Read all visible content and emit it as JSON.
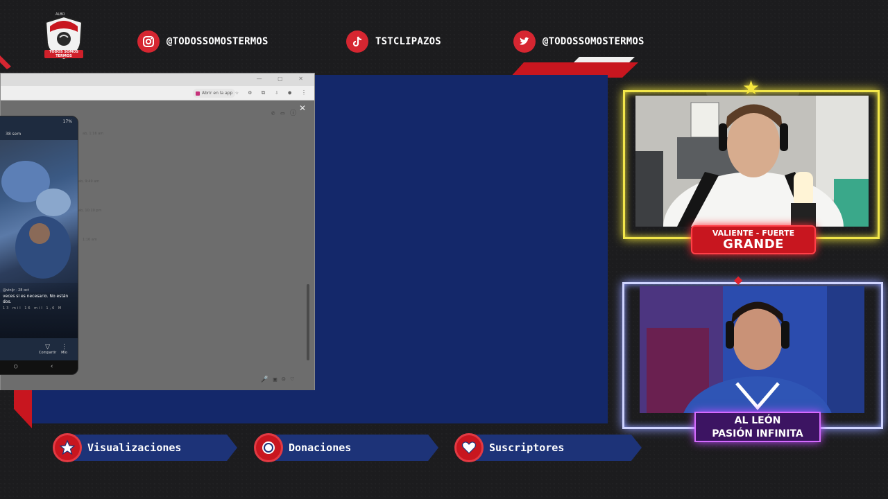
{
  "logo": {
    "top_text": "ALBO",
    "badge_text": "TODOS SOMOS TERMOS"
  },
  "socials": [
    {
      "platform": "instagram",
      "icon": "instagram-icon",
      "handle": "@TODOSSOMOSTERMOS"
    },
    {
      "platform": "tiktok",
      "icon": "tiktok-icon",
      "handle": "TSTCLIPAZOS"
    },
    {
      "platform": "twitter",
      "icon": "twitter-icon",
      "handle": "@TODOSSOMOSTERMOS"
    }
  ],
  "browser": {
    "abrir_label": "Abrir en la app",
    "timestamps": [
      "ab, 1:16 am",
      "ab, 9:49 am",
      "ab, 10:10 pm",
      "1:16 am"
    ]
  },
  "phone": {
    "status": "17%",
    "post_time": "38 sem",
    "caption_user": "@vinijr · 28 oct",
    "caption_text": "veces si es necesario. No están dos.",
    "caption_stats": "13 mil   16 mil   1,6 M",
    "action_share": "Compartir",
    "action_mine": "Mío"
  },
  "cam1": {
    "label_top": "VALIENTE - FUERTE",
    "label_main": "GRANDE"
  },
  "cam2": {
    "label_line1": "AL LEÓN",
    "label_line2": "PASIÓN INFINITA"
  },
  "stats": [
    {
      "icon": "star-icon",
      "label": "Visualizaciones"
    },
    {
      "icon": "coin-icon",
      "label": "Donaciones"
    },
    {
      "icon": "heart-icon",
      "label": "Suscriptores"
    }
  ],
  "colors": {
    "background": "#1c1c1e",
    "panel_blue": "#14286a",
    "brand_red": "#d62631",
    "cam1_neon": "#f2e64a",
    "cam2_neon": "#cfd4ff",
    "cam2_label": "#3c1462"
  }
}
